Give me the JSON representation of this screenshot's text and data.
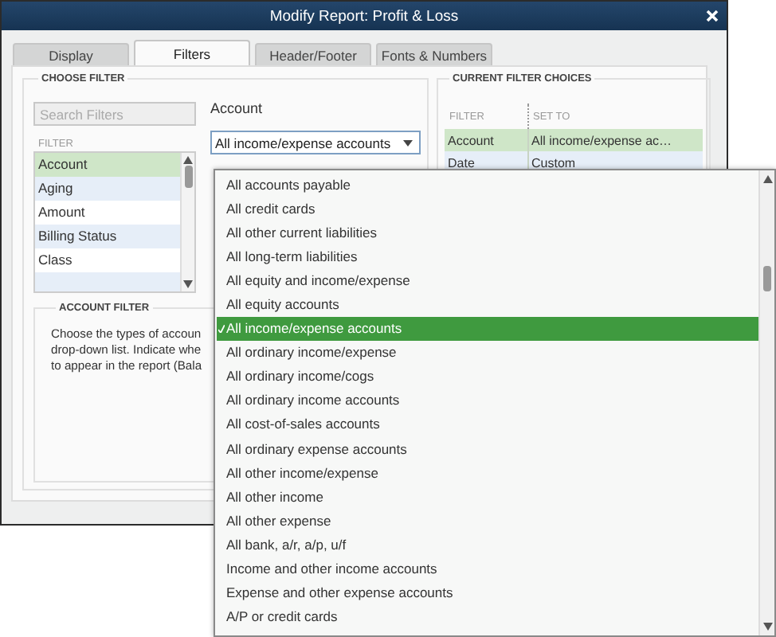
{
  "window": {
    "title": "Modify Report: Profit & Loss"
  },
  "tabs": [
    {
      "label": "Display",
      "selected": false
    },
    {
      "label": "Filters",
      "selected": true
    },
    {
      "label": "Header/Footer",
      "selected": false
    },
    {
      "label": "Fonts & Numbers",
      "selected": false
    }
  ],
  "choose_filter": {
    "heading": "CHOOSE FILTER",
    "search": {
      "placeholder": "Search Filters"
    },
    "list_header": "FILTER",
    "filters": [
      {
        "label": "Account",
        "selected": true
      },
      {
        "label": "Aging",
        "selected": false
      },
      {
        "label": "Amount",
        "selected": false
      },
      {
        "label": "Billing Status",
        "selected": false
      },
      {
        "label": "Class",
        "selected": false
      }
    ],
    "field_label": "Account",
    "dropdown": {
      "value": "All income/expense accounts"
    }
  },
  "account_filter": {
    "heading": "ACCOUNT FILTER",
    "text": "Choose the types of accoun\ndrop-down list. Indicate whe\nto appear in the report (Bala"
  },
  "current_filter_choices": {
    "heading": "CURRENT FILTER CHOICES",
    "columns": [
      "FILTER",
      "SET TO"
    ],
    "rows": [
      {
        "filter": "Account",
        "set_to": "All income/expense ac…",
        "selected": true
      },
      {
        "filter": "Date",
        "set_to": "Custom",
        "selected": false
      }
    ]
  },
  "dropdown_menu": {
    "options": [
      {
        "label": "All accounts payable",
        "selected": false
      },
      {
        "label": "All credit cards",
        "selected": false
      },
      {
        "label": "All other current liabilities",
        "selected": false
      },
      {
        "label": "All long-term liabilities",
        "selected": false
      },
      {
        "label": "All equity and income/expense",
        "selected": false
      },
      {
        "label": "All equity accounts",
        "selected": false
      },
      {
        "label": "All income/expense accounts",
        "selected": true
      },
      {
        "label": "All ordinary income/expense",
        "selected": false
      },
      {
        "label": "All ordinary income/cogs",
        "selected": false
      },
      {
        "label": "All ordinary income accounts",
        "selected": false
      },
      {
        "label": "All cost-of-sales accounts",
        "selected": false
      },
      {
        "label": "All ordinary expense accounts",
        "selected": false
      },
      {
        "label": "All other income/expense",
        "selected": false
      },
      {
        "label": "All other income",
        "selected": false
      },
      {
        "label": "All other expense",
        "selected": false
      },
      {
        "label": "All bank, a/r, a/p, u/f",
        "selected": false
      },
      {
        "label": "Income and other income accounts",
        "selected": false
      },
      {
        "label": "Expense and other expense accounts",
        "selected": false
      },
      {
        "label": "A/P or credit cards",
        "selected": false
      }
    ]
  }
}
